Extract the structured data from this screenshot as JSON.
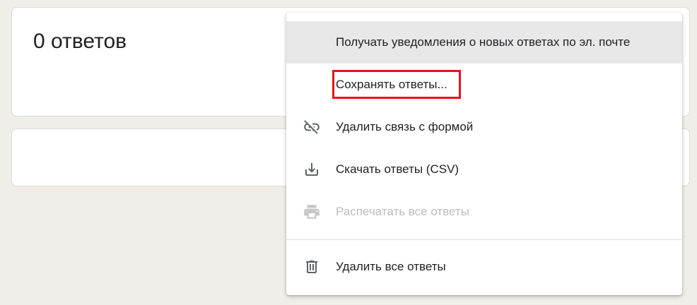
{
  "summary": {
    "response_count_label": "0 ответов"
  },
  "menu": {
    "items": [
      {
        "label": "Получать уведомления о новых ответах по эл. почте",
        "icon": "none",
        "state": "highlighted"
      },
      {
        "label": "Сохранять ответы...",
        "icon": "none",
        "state": "outlined"
      },
      {
        "label": "Удалить связь с формой",
        "icon": "link-off-icon",
        "state": "enabled"
      },
      {
        "label": "Скачать ответы (CSV)",
        "icon": "download-icon",
        "state": "enabled"
      },
      {
        "label": "Распечатать все ответы",
        "icon": "print-icon",
        "state": "disabled"
      },
      {
        "label": "Удалить все ответы",
        "icon": "trash-icon",
        "state": "enabled"
      }
    ]
  },
  "colors": {
    "page_background": "#efeee8",
    "highlight": "#e8e8e8",
    "outline_red": "#e3141b",
    "icon_gray": "#5f6368",
    "disabled_gray": "#bdbdbd"
  }
}
